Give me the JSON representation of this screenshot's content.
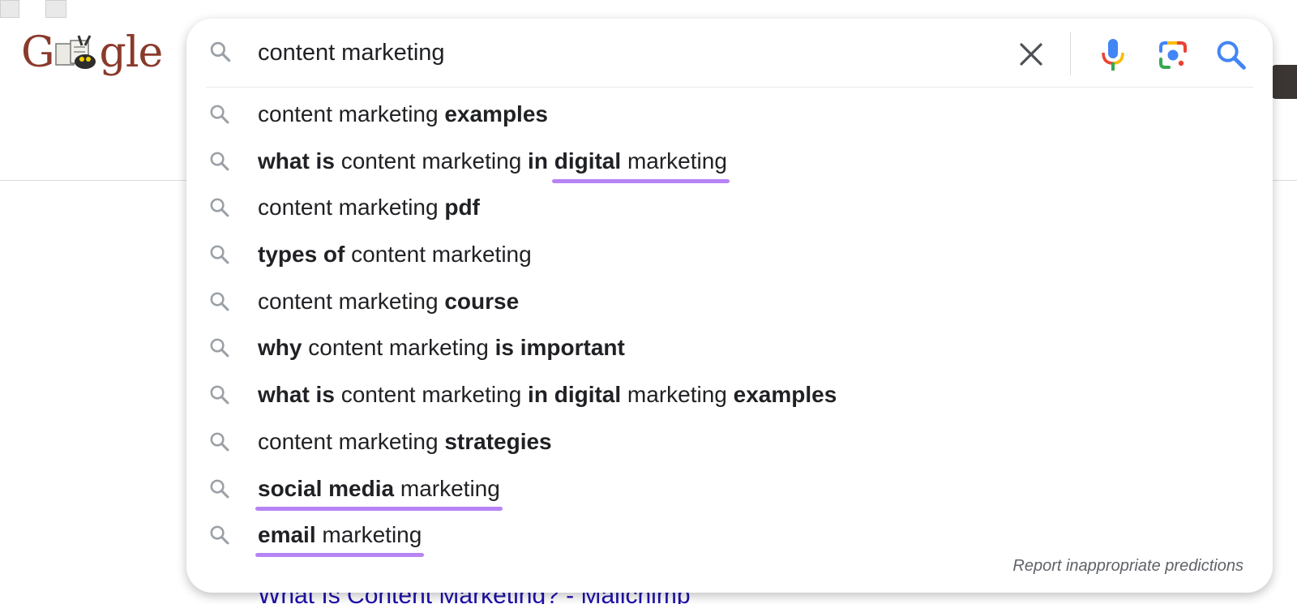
{
  "logo": {
    "text_left": "G",
    "text_right": "gle"
  },
  "search": {
    "value": "content marketing",
    "placeholder": ""
  },
  "icons": {
    "search": "magnifier-icon",
    "clear": "close-icon",
    "voice": "microphone-icon",
    "lens": "camera-lens-icon",
    "submit": "search-icon"
  },
  "colors": {
    "highlight_underline": "#b784f5",
    "suggestion_icon": "#9aa0a6",
    "search_button": "#4285f4",
    "result_link": "#1a0dab"
  },
  "suggestions": [
    {
      "parts": [
        {
          "t": "content marketing ",
          "b": false
        },
        {
          "t": "examples",
          "b": true
        }
      ]
    },
    {
      "parts": [
        {
          "t": "what is",
          "b": true
        },
        {
          "t": " content marketing ",
          "b": false
        },
        {
          "t": "in ",
          "b": true
        },
        {
          "t": "digital",
          "b": true,
          "hl": true
        },
        {
          "t": " marketing",
          "b": false,
          "hl": true
        }
      ]
    },
    {
      "parts": [
        {
          "t": "content marketing ",
          "b": false
        },
        {
          "t": "pdf",
          "b": true
        }
      ]
    },
    {
      "parts": [
        {
          "t": "types of",
          "b": true
        },
        {
          "t": " content marketing",
          "b": false
        }
      ]
    },
    {
      "parts": [
        {
          "t": "content marketing ",
          "b": false
        },
        {
          "t": "course",
          "b": true
        }
      ]
    },
    {
      "parts": [
        {
          "t": "why",
          "b": true
        },
        {
          "t": " content marketing ",
          "b": false
        },
        {
          "t": "is important",
          "b": true
        }
      ]
    },
    {
      "parts": [
        {
          "t": "what is",
          "b": true
        },
        {
          "t": " content marketing ",
          "b": false
        },
        {
          "t": "in digital",
          "b": true
        },
        {
          "t": " marketing ",
          "b": false
        },
        {
          "t": "examples",
          "b": true
        }
      ]
    },
    {
      "parts": [
        {
          "t": "content marketing ",
          "b": false
        },
        {
          "t": "strategies",
          "b": true
        }
      ]
    },
    {
      "parts": [
        {
          "t": "social media",
          "b": true,
          "hl": true
        },
        {
          "t": " marketing",
          "b": false,
          "hl": true
        }
      ]
    },
    {
      "parts": [
        {
          "t": "email",
          "b": true,
          "hl": true
        },
        {
          "t": " marketing",
          "b": false,
          "hl": true
        }
      ]
    }
  ],
  "report_link": "Report inappropriate predictions",
  "result_title": "What Is Content Marketing? - Mailchimp"
}
